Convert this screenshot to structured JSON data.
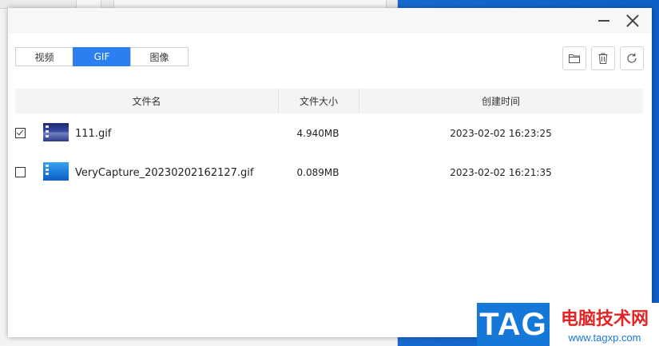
{
  "tabs": [
    {
      "label": "视频",
      "active": false
    },
    {
      "label": "GIF",
      "active": true
    },
    {
      "label": "图像",
      "active": false
    }
  ],
  "toolbar": {
    "open_folder_icon": "folder-icon",
    "delete_icon": "trash-icon",
    "refresh_icon": "refresh-icon"
  },
  "window_controls": {
    "minimize_icon": "minimize-icon",
    "close_icon": "close-icon"
  },
  "table": {
    "columns": [
      "文件名",
      "文件大小",
      "创建时间"
    ],
    "rows": [
      {
        "checked": true,
        "name": "111.gif",
        "size": "4.940MB",
        "created": "2023-02-02 16:23:25"
      },
      {
        "checked": false,
        "name": "VeryCapture_20230202162127.gif",
        "size": "0.089MB",
        "created": "2023-02-02 16:21:35"
      }
    ]
  },
  "watermark": {
    "logo": "TAG",
    "site_name": "电脑技术网",
    "url": "www.tagxp.com"
  },
  "colors": {
    "accent": "#2c7ff0",
    "header_bg": "#f4f4f4",
    "watermark_blue": "#1577d8",
    "watermark_red": "#e32424"
  }
}
